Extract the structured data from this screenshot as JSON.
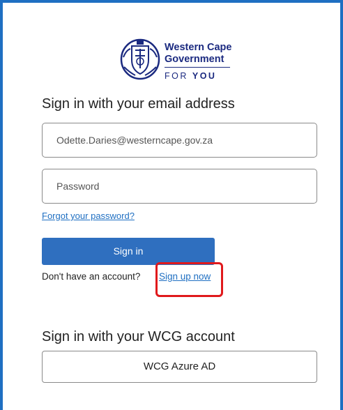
{
  "logo": {
    "line1": "Western Cape",
    "line2": "Government",
    "tag_prefix": "FOR ",
    "tag_strong": "YOU",
    "brand_color": "#1b2a80"
  },
  "email_section": {
    "heading": "Sign in with your email address",
    "email_value": "Odette.Daries@westerncape.gov.za",
    "password_placeholder": "Password",
    "forgot_link": "Forgot your password?",
    "signin_label": "Sign in",
    "no_account_text": "Don't have an account?",
    "signup_link": "Sign up now"
  },
  "wcg_section": {
    "heading": "Sign in with your WCG account",
    "azure_label": "WCG Azure AD"
  },
  "colors": {
    "accent": "#2f6fbf",
    "link": "#1f6fc2",
    "frame": "#1f6fc2",
    "highlight": "#e0191c"
  }
}
